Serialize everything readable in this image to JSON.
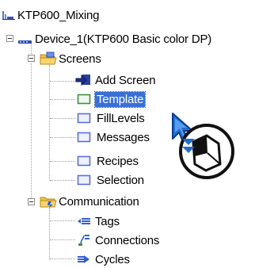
{
  "tree": {
    "project": {
      "label": "KTP600_Mixing",
      "icon": "project-icon"
    },
    "device": {
      "label": "Device_1(KTP600 Basic color DP)",
      "icon": "device-icon"
    },
    "screens": {
      "label": "Screens",
      "icon": "folder-screens-icon",
      "items": [
        {
          "label": "Add Screen",
          "icon": "add-screen-icon"
        },
        {
          "label": "Template",
          "icon": "screen-template-icon",
          "selected": true
        },
        {
          "label": "FillLevels",
          "icon": "screen-icon"
        },
        {
          "label": "Messages",
          "icon": "screen-icon"
        },
        {
          "label": "Recipes",
          "icon": "screen-icon"
        },
        {
          "label": "Selection",
          "icon": "screen-icon"
        }
      ]
    },
    "communication": {
      "label": "Communication",
      "icon": "folder-communication-icon",
      "items": [
        {
          "label": "Tags",
          "icon": "tags-icon"
        },
        {
          "label": "Connections",
          "icon": "connections-icon"
        },
        {
          "label": "Cycles",
          "icon": "cycles-icon"
        }
      ]
    }
  },
  "colors": {
    "selection": "#3a6fd8",
    "screen_icon_border": "#5b6fd6",
    "template_icon_border": "#3d8f3d",
    "cursor_blue": "#1f6fd0"
  }
}
